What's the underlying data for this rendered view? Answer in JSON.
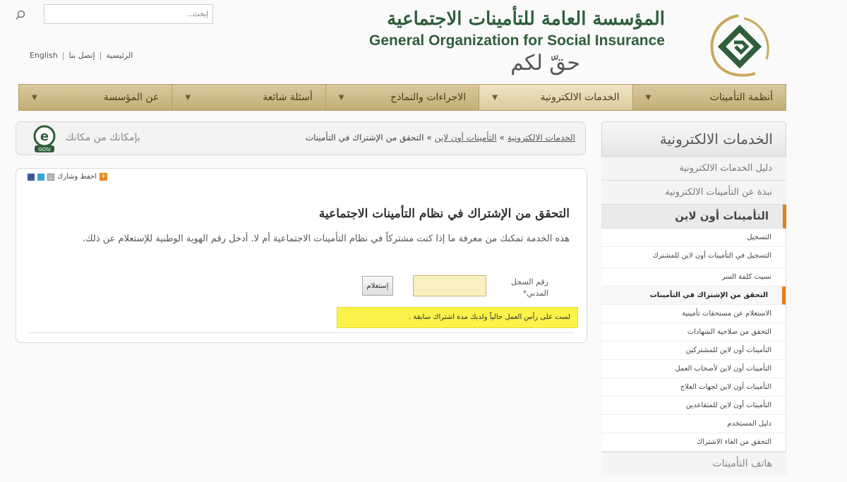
{
  "header": {
    "search_placeholder": "إبحث...",
    "links": [
      "English",
      "إتصل بنا",
      "الرئيسية"
    ],
    "org_name_ar": "المؤسسة العامة للتأمينات الاجتماعية",
    "org_name_en": "General Organization for Social Insurance",
    "slogan": "حقّ لكم"
  },
  "nav": {
    "items": [
      {
        "label": "أنظمة التأمينات",
        "active": false
      },
      {
        "label": "الخدمات الالكترونية",
        "active": true
      },
      {
        "label": "الاجراءات والنماذج",
        "active": false
      },
      {
        "label": "أسئلة شائعة",
        "active": false
      },
      {
        "label": "عن المؤسسة",
        "active": false
      }
    ]
  },
  "breadcrumb": {
    "items": [
      "الخدمات الالكترونية",
      "التأمينات أون لاين",
      "التحقق من الإشتراك في التأمينات"
    ],
    "separator": "»",
    "slogan": "بإمكانك من مكانك",
    "badge": "GOSI"
  },
  "content": {
    "share_label": "احفظ وشارك",
    "title": "التحقق من الإشتراك في نظام التأمينات الاجتماعية",
    "description": "هذه الخدمة تمكنك من معرفة ما إذا كنت مشتركاً في نظام التأمينات الاجتماعية أم لا. أدخل رقم الهوية الوطنية للإستعلام عن ذلك.",
    "field_label": "رقم السجل المدني*",
    "field_value": "",
    "button_label": "إستعلام",
    "notice": "لست على رأس العمل حالياً ولديك مدة اشتراك سابقة ."
  },
  "sidebar": {
    "title": "الخدمات الالكترونية",
    "items": [
      "دليل الخدمات الالكترونية",
      "نبذة عن التأمينات الالكترونية"
    ],
    "current": "التأمينات أون لاين",
    "sub_items": [
      {
        "label": "التسجيل",
        "active": false
      },
      {
        "label": "التسجيل في التأمينات أون لاين للمشترك",
        "active": false
      },
      {
        "label": "نسيت كلمة السر",
        "active": false
      },
      {
        "label": "التحقق من الإشتراك في التأمينات",
        "active": true
      },
      {
        "label": "الاستعلام عن مستحقات تأمينية",
        "active": false
      },
      {
        "label": "التحقق من صلاحية الشهادات",
        "active": false
      },
      {
        "label": "التأمينات أون لاين للمشتركين",
        "active": false
      },
      {
        "label": "التأمينات أون لاين لأصحاب العمل",
        "active": false
      },
      {
        "label": "التأمينات أون لاين لجهات العلاج",
        "active": false
      },
      {
        "label": "التأمينات أون لاين للمتقاعدين",
        "active": false
      },
      {
        "label": "دليل المستخدم",
        "active": false
      },
      {
        "label": "التحقق من الغاء الاشتراك",
        "active": false
      }
    ],
    "bottom_item": "هاتف التأمينات"
  },
  "colors": {
    "brand_green": "#2f5e3a",
    "brand_gold": "#c4ae78",
    "accent_orange": "#e07f1f",
    "notice_yellow": "#fbf24a"
  }
}
